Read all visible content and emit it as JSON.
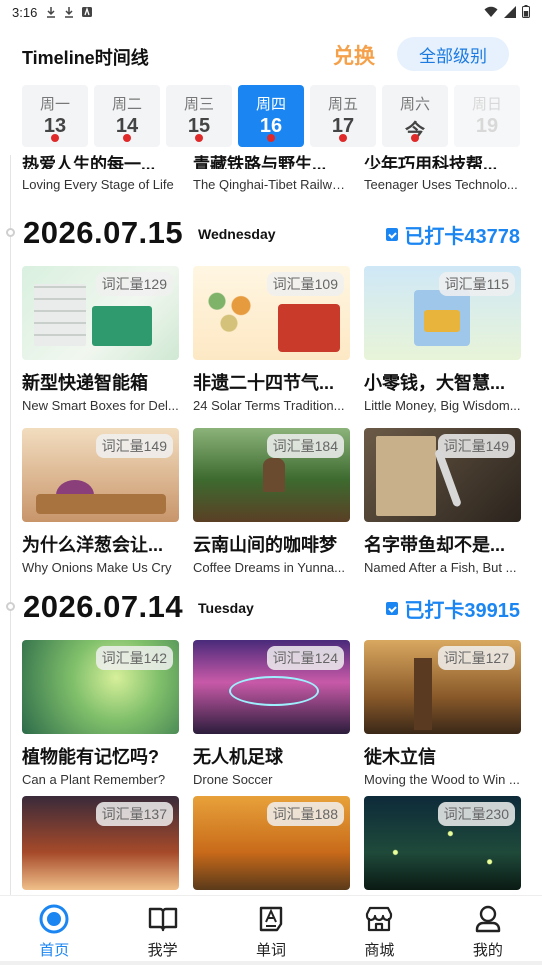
{
  "status": {
    "time": "3:16"
  },
  "header": {
    "title": "Timeline时间线",
    "exchange_label": "兑换",
    "level_label": "全部级别"
  },
  "week": [
    {
      "name": "周一",
      "date": "13",
      "state": "dot"
    },
    {
      "name": "周二",
      "date": "14",
      "state": "dot"
    },
    {
      "name": "周三",
      "date": "15",
      "state": "dot"
    },
    {
      "name": "周四",
      "date": "16",
      "state": "active"
    },
    {
      "name": "周五",
      "date": "17",
      "state": "dot"
    },
    {
      "name": "周六",
      "date": "今",
      "state": "dot"
    },
    {
      "name": "周日",
      "date": "19",
      "state": "future"
    }
  ],
  "partial_row": [
    {
      "title": "热爱人生的每一...",
      "subtitle": "Loving Every Stage of Life"
    },
    {
      "title": "青藏铁路与野生...",
      "subtitle": "The Qinghai-Tibet Railwa..."
    },
    {
      "title": "少年巧用科技帮...",
      "subtitle": "Teenager Uses Technolo..."
    }
  ],
  "sections": [
    {
      "date": "2026.07.15",
      "weekday": "Wednesday",
      "checkin": "已打卡43778",
      "rows": [
        [
          {
            "vocab": "词汇量129",
            "title": "新型快递智能箱",
            "subtitle": "New Smart Boxes for Del..."
          },
          {
            "vocab": "词汇量109",
            "title": "非遗二十四节气...",
            "subtitle": "24 Solar Terms Tradition..."
          },
          {
            "vocab": "词汇量115",
            "title": "小零钱，大智慧...",
            "subtitle": "Little Money, Big Wisdom..."
          }
        ],
        [
          {
            "vocab": "词汇量149",
            "title": "为什么洋葱会让...",
            "subtitle": "Why Onions Make Us Cry"
          },
          {
            "vocab": "词汇量184",
            "title": "云南山间的咖啡梦",
            "subtitle": "Coffee Dreams in Yunna..."
          },
          {
            "vocab": "词汇量149",
            "title": "名字带鱼却不是...",
            "subtitle": "Named After a Fish, But ..."
          }
        ]
      ]
    },
    {
      "date": "2026.07.14",
      "weekday": "Tuesday",
      "checkin": "已打卡39915",
      "rows": [
        [
          {
            "vocab": "词汇量142",
            "title": "植物能有记忆吗?",
            "subtitle": "Can a Plant Remember?"
          },
          {
            "vocab": "词汇量124",
            "title": "无人机足球",
            "subtitle": "Drone Soccer"
          },
          {
            "vocab": "词汇量127",
            "title": "徙木立信",
            "subtitle": "Moving the Wood to Win ..."
          }
        ],
        [
          {
            "vocab": "词汇量137",
            "title": "",
            "subtitle": ""
          },
          {
            "vocab": "词汇量188",
            "title": "",
            "subtitle": ""
          },
          {
            "vocab": "词汇量230",
            "title": "",
            "subtitle": ""
          }
        ]
      ]
    }
  ],
  "nav": [
    {
      "label": "首页",
      "icon": "home-icon",
      "active": true
    },
    {
      "label": "我学",
      "icon": "book-icon",
      "active": false
    },
    {
      "label": "单词",
      "icon": "word-icon",
      "active": false
    },
    {
      "label": "商城",
      "icon": "shop-icon",
      "active": false
    },
    {
      "label": "我的",
      "icon": "profile-icon",
      "active": false
    }
  ],
  "colors": {
    "accent": "#1b86f2",
    "exchange": "#f5a04a",
    "dot": "#e02a2a"
  }
}
